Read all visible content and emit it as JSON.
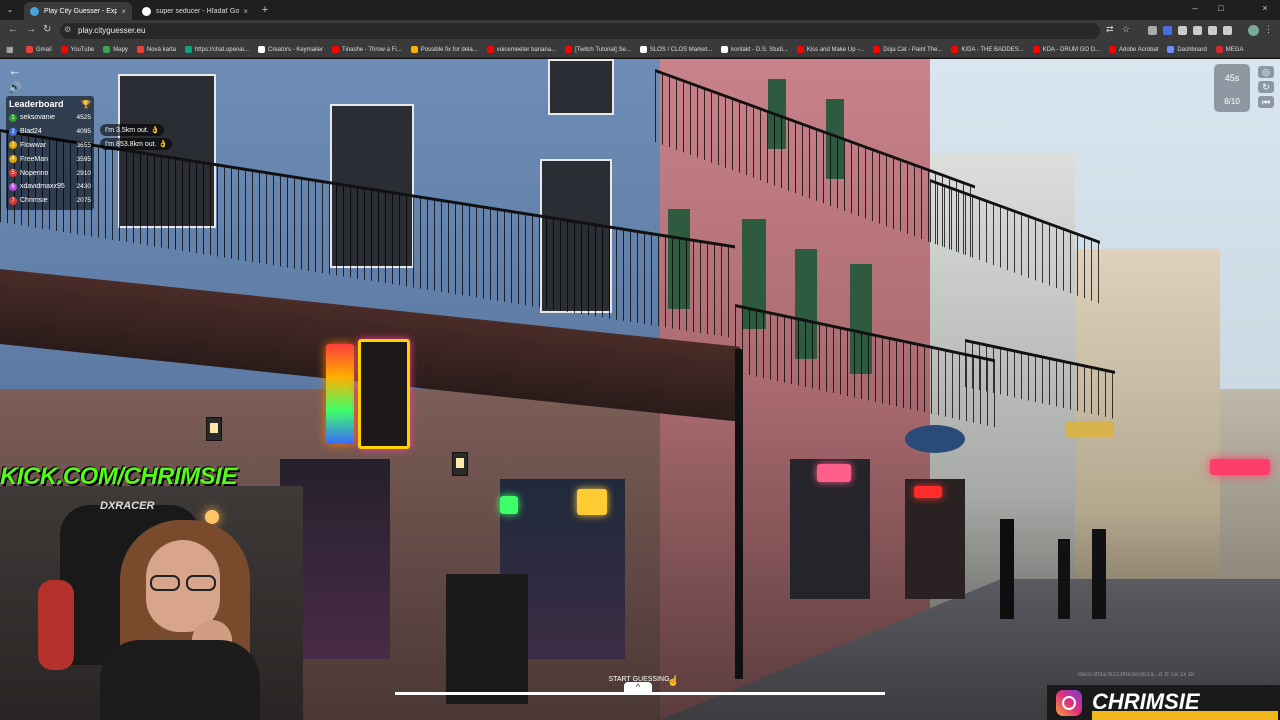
{
  "browser": {
    "tabs": [
      {
        "label": "Play City Guesser - Explore",
        "active": true,
        "icon_color": "#4aa3df"
      },
      {
        "label": "super seducer - Hľadať Googlom",
        "active": false,
        "icon_color": "#ffffff"
      }
    ],
    "url": "play.cityguesser.eu",
    "bookmarks": [
      {
        "label": "Gmail",
        "color": "#ea4335"
      },
      {
        "label": "YouTube",
        "color": "#ff0000"
      },
      {
        "label": "Mapy",
        "color": "#34a853"
      },
      {
        "label": "Nová karta",
        "color": "#ea4335"
      },
      {
        "label": "https://chat.openai...",
        "color": "#10a37f"
      },
      {
        "label": "Creators - Keymailer",
        "color": "#ffffff"
      },
      {
        "label": "Tinashe - Throw a Fi...",
        "color": "#ff0000"
      },
      {
        "label": "Possible fix for dela...",
        "color": "#f5b400"
      },
      {
        "label": "voicemeeter banana...",
        "color": "#ff0000"
      },
      {
        "label": "[Twitch Tutorial] Se...",
        "color": "#ff0000"
      },
      {
        "label": "SLOS / CLOS Market...",
        "color": "#ffffff"
      },
      {
        "label": "kontakt - D.S. Studi...",
        "color": "#ffffff"
      },
      {
        "label": "Kiss and Make Up -...",
        "color": "#ff0000"
      },
      {
        "label": "Doja Cat - Paint The...",
        "color": "#ff0000"
      },
      {
        "label": "K/DA - THE BADDES...",
        "color": "#ff0000"
      },
      {
        "label": "KDA - DRUM GO D...",
        "color": "#ff0000"
      },
      {
        "label": "Adobe Acrobat",
        "color": "#ff0000"
      },
      {
        "label": "Dashboard",
        "color": "#6e8cff"
      },
      {
        "label": "MEGA",
        "color": "#d9272e"
      }
    ]
  },
  "hud": {
    "leaderboard_title": "Leaderboard",
    "leaderboard": [
      {
        "rank": "1",
        "name": "seksovanie",
        "score": "4525",
        "color": "#2ca02c"
      },
      {
        "rank": "2",
        "name": "Blad24",
        "score": "4095",
        "color": "#3a6fd8"
      },
      {
        "rank": "3",
        "name": "Flowwar",
        "score": "3655",
        "color": "#d9a700"
      },
      {
        "rank": "4",
        "name": "FreeMan",
        "score": "3595",
        "color": "#d9a700"
      },
      {
        "rank": "5",
        "name": "Noperino",
        "score": "2910",
        "color": "#d83a3a"
      },
      {
        "rank": "6",
        "name": "xdavidmaxx95",
        "score": "2430",
        "color": "#b04ad8"
      },
      {
        "rank": "7",
        "name": "Chrimsie",
        "score": "2075",
        "color": "#d83a3a"
      }
    ],
    "bubbles": [
      "I'm 3.5km out. 👌",
      "I'm 853.8km out. 👌"
    ],
    "timer": "45s",
    "round": "8/10",
    "start_guessing": "START GUESSING",
    "coords": "idesc-8f3a7b213f0e3e59c1a...d 3f 1w 1x 1k"
  },
  "stream": {
    "kick_url": "KICK.COM/CHRIMSIE",
    "chair_brand": "DXRACER",
    "insta_handle": "CHRIMSIE"
  },
  "colors": {
    "kick_green": "#53fc18",
    "insta_yellow": "#f2b51c"
  }
}
